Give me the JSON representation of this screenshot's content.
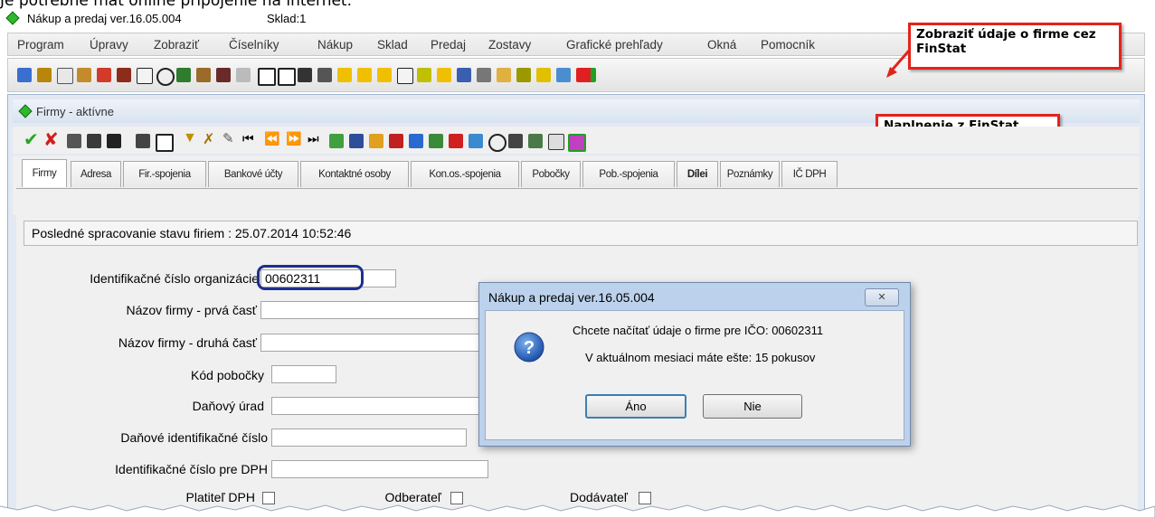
{
  "top_cut_text": "Je potrebné mať online pripojenie na internet.",
  "app": {
    "title": "Nákup a predaj ver.16.05.004",
    "warehouse": "Sklad:1"
  },
  "menu": [
    "Program",
    "Úpravy",
    "Zobraziť",
    "Číselníky",
    "Nákup",
    "Sklad",
    "Predaj",
    "Zostavy",
    "Grafické prehľady",
    "Okná",
    "Pomocník"
  ],
  "callouts": {
    "finstat_show": "Zobraziť údaje o firme cez FinStat",
    "finstat_fill": "Naplnenie z FinStat"
  },
  "child_window": {
    "title": "Firmy - aktívne"
  },
  "tabs": [
    "Firmy",
    "Adresa",
    "Fir.-spojenia",
    "Bankové účty",
    "Kontaktné osoby",
    "Kon.os.-spojenia",
    "Pobočky",
    "Pob.-spojenia",
    "Dílei",
    "Poznámky",
    "IČ DPH"
  ],
  "status_line": "Posledné spracovanie stavu firiem : 25.07.2014 10:52:46",
  "form": {
    "ico_label": "Identifikačné číslo organizácie",
    "ico_value": "00602311",
    "name1_label": "Názov firmy - prvá časť",
    "name2_label": "Názov firmy - druhá časť",
    "branch_label": "Kód pobočky",
    "tax_office_label": "Daňový úrad",
    "dic_label": "Daňové identifikačné číslo",
    "icdph_label": "Identifikačné číslo pre DPH",
    "vat_payer_label": "Platiteľ DPH",
    "customer_label": "Odberateľ",
    "supplier_label": "Dodávateľ"
  },
  "dialog": {
    "title": "Nákup a predaj ver.16.05.004",
    "close": "✕",
    "message1": "Chcete načítať údaje o firme pre IČO: 00602311",
    "message2": "V aktuálnom mesiaci máte ešte: 15 pokusov",
    "yes": "Áno",
    "no": "Nie",
    "icon": "question-icon"
  },
  "colors": {
    "callout_border": "#e2231a",
    "highlight_ring": "#1c2f8f",
    "app_icon": "#2fb82f"
  }
}
